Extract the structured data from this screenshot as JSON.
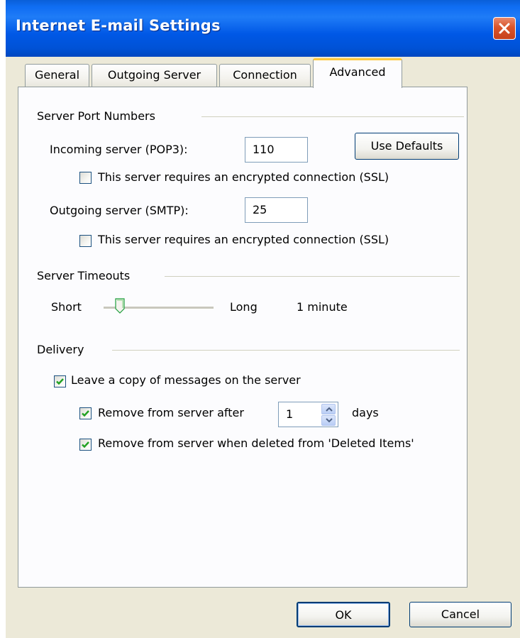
{
  "window": {
    "title": "Internet E-mail Settings",
    "close_icon": "close-icon"
  },
  "tabs": [
    {
      "label": "General"
    },
    {
      "label": "Outgoing Server"
    },
    {
      "label": "Connection"
    },
    {
      "label": "Advanced",
      "active": true
    }
  ],
  "server_ports": {
    "heading": "Server Port Numbers",
    "incoming_label": "Incoming server (POP3):",
    "incoming_value": "110",
    "use_defaults": "Use Defaults",
    "incoming_ssl_label": "This server requires an encrypted connection (SSL)",
    "incoming_ssl_checked": false,
    "outgoing_label": "Outgoing server (SMTP):",
    "outgoing_value": "25",
    "outgoing_ssl_label": "This server requires an encrypted connection (SSL)",
    "outgoing_ssl_checked": false
  },
  "timeouts": {
    "heading": "Server Timeouts",
    "short_label": "Short",
    "long_label": "Long",
    "value_text": "1 minute",
    "slider_level": 0.15
  },
  "delivery": {
    "heading": "Delivery",
    "leave_copy_label": "Leave a copy of messages on the server",
    "leave_copy_checked": true,
    "remove_after_label": "Remove from server after",
    "remove_after_checked": true,
    "remove_after_days": "1",
    "days_label": "days",
    "remove_deleted_label": "Remove from server when deleted from 'Deleted Items'",
    "remove_deleted_checked": true
  },
  "buttons": {
    "ok": "OK",
    "cancel": "Cancel"
  },
  "colors": {
    "titlebar": "#0058e6",
    "dialog_bg": "#ece9d8",
    "panel_bg": "#fcfcfe",
    "tab_highlight": "#ffc83c",
    "check": "#21a121"
  }
}
